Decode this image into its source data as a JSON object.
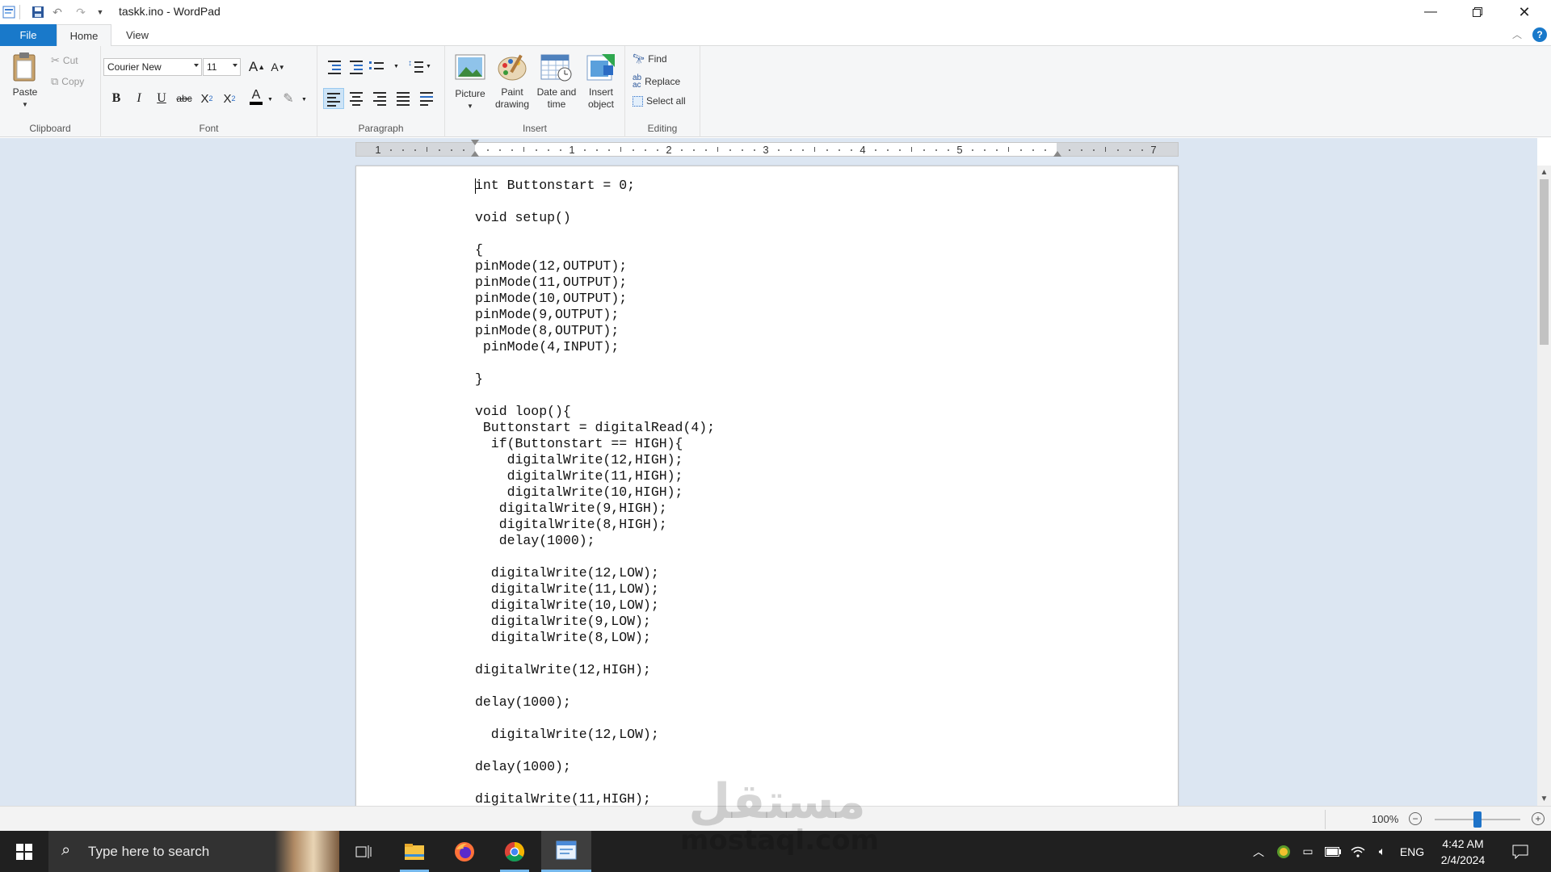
{
  "window": {
    "title": "taskk.ino - WordPad"
  },
  "tabs": {
    "file": "File",
    "home": "Home",
    "view": "View"
  },
  "clipboard": {
    "paste": "Paste",
    "cut": "Cut",
    "copy": "Copy",
    "label": "Clipboard"
  },
  "font": {
    "family": "Courier New",
    "size": "11",
    "label": "Font"
  },
  "paragraph": {
    "label": "Paragraph"
  },
  "insert": {
    "picture": "Picture",
    "paint_line1": "Paint",
    "paint_line2": "drawing",
    "datetime_line1": "Date and",
    "datetime_line2": "time",
    "object_line1": "Insert",
    "object_line2": "object",
    "label": "Insert"
  },
  "editing": {
    "find": "Find",
    "replace": "Replace",
    "select_all": "Select all",
    "label": "Editing"
  },
  "ruler": {
    "numbers": [
      "1",
      "1",
      "2",
      "3",
      "4",
      "5",
      "7"
    ]
  },
  "document": {
    "lines": [
      "int Buttonstart = 0;",
      "",
      "void setup()",
      "",
      "{",
      "pinMode(12,OUTPUT);",
      "pinMode(11,OUTPUT);",
      "pinMode(10,OUTPUT);",
      "pinMode(9,OUTPUT);",
      "pinMode(8,OUTPUT);",
      " pinMode(4,INPUT);",
      "",
      "}",
      "",
      "void loop(){",
      " Buttonstart = digitalRead(4);",
      "  if(Buttonstart == HIGH){",
      "    digitalWrite(12,HIGH);",
      "    digitalWrite(11,HIGH);",
      "    digitalWrite(10,HIGH);",
      "   digitalWrite(9,HIGH);",
      "   digitalWrite(8,HIGH);",
      "   delay(1000);",
      "",
      "  digitalWrite(12,LOW);",
      "  digitalWrite(11,LOW);",
      "  digitalWrite(10,LOW);",
      "  digitalWrite(9,LOW);",
      "  digitalWrite(8,LOW);",
      "",
      "digitalWrite(12,HIGH);",
      "",
      "delay(1000);",
      "",
      "  digitalWrite(12,LOW);",
      "",
      "delay(1000);",
      "",
      "digitalWrite(11,HIGH);"
    ]
  },
  "status": {
    "zoom": "100%",
    "zoom_level": 1.0
  },
  "watermark": {
    "arabic": "مستقل",
    "latin": "mostaql.com"
  },
  "taskbar": {
    "search_placeholder": "Type here to search",
    "lang": "ENG",
    "time": "4:42 AM",
    "date": "2/4/2024"
  },
  "colors": {
    "accent": "#1979ca",
    "file_tab": "#1979ca",
    "taskbar": "#202020",
    "doc_bg": "#dce6f2"
  }
}
